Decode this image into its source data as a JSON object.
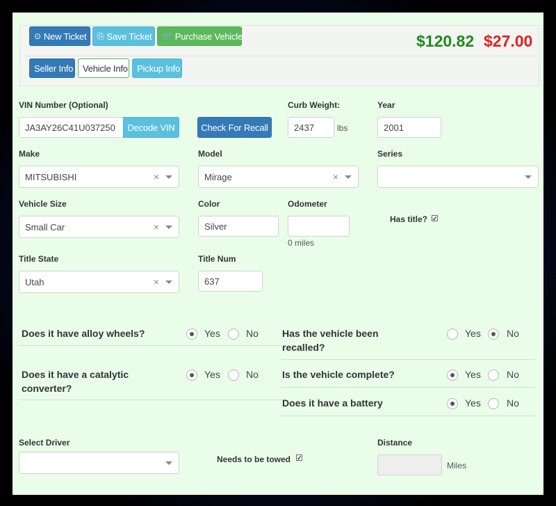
{
  "toolbar": {
    "new_ticket": "New Ticket",
    "save_ticket": "Save Ticket",
    "purchase_vehicle": "Purchase Vehicle",
    "price_green": "$120.82",
    "price_red": "$27.00"
  },
  "tabs": {
    "seller": "Seller Info",
    "vehicle": "Vehicle Info",
    "pickup": "Pickup Info"
  },
  "vin": {
    "label": "VIN Number (Optional)",
    "value": "JA3AY26C41U037250",
    "decode_button": "Decode VIN"
  },
  "recall_button": "Check For Recall",
  "curb_weight": {
    "label": "Curb Weight:",
    "value": "2437",
    "unit": "lbs"
  },
  "year": {
    "label": "Year",
    "value": "2001"
  },
  "make": {
    "label": "Make",
    "value": "MITSUBISHI"
  },
  "model": {
    "label": "Model",
    "value": "Mirage"
  },
  "series": {
    "label": "Series",
    "value": ""
  },
  "vehicle_size": {
    "label": "Vehicle Size",
    "value": "Small Car"
  },
  "color": {
    "label": "Color",
    "value": "Silver"
  },
  "odometer": {
    "label": "Odometer",
    "value": "",
    "note": "0 miles"
  },
  "has_title": {
    "label": "Has title?",
    "checked": true
  },
  "title_state": {
    "label": "Title State",
    "value": "Utah"
  },
  "title_num": {
    "label": "Title Num",
    "value": "637"
  },
  "radio_yes": "Yes",
  "radio_no": "No",
  "questions": {
    "alloy": {
      "text": "Does it have alloy wheels?",
      "answer": "Yes"
    },
    "recalled_1": "Has the vehicle been",
    "recalled_2": "recalled?",
    "recalled_answer": "No",
    "catalytic_1": "Does it have a catalytic",
    "catalytic_2": "converter?",
    "catalytic_answer": "Yes",
    "complete": {
      "text": "Is the vehicle complete?",
      "answer": "Yes"
    },
    "battery": {
      "text": "Does it have a battery",
      "answer": "Yes"
    }
  },
  "driver": {
    "label": "Select Driver",
    "value": ""
  },
  "towed": {
    "label": "Needs to be towed",
    "checked": true
  },
  "distance": {
    "label": "Distance",
    "value": "",
    "unit": "Miles"
  },
  "colors": {
    "panel_bg": "#e9fde9",
    "primary": "#337ab7",
    "info": "#5bc0de",
    "success": "#5cb85c",
    "price_green": "#1e8a1e",
    "price_red": "#e32020"
  }
}
